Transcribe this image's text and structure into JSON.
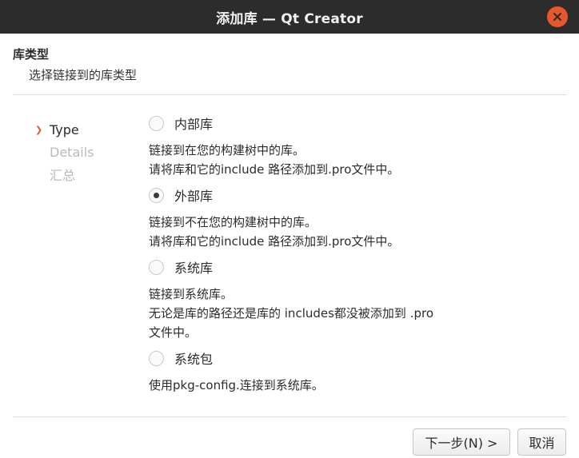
{
  "window": {
    "title": "添加库 — Qt Creator"
  },
  "header": {
    "title": "库类型",
    "subtitle": "选择链接到的库类型"
  },
  "steps": [
    {
      "label": "Type",
      "current": true
    },
    {
      "label": "Details",
      "current": false
    },
    {
      "label": "汇总",
      "current": false
    }
  ],
  "options": [
    {
      "label": "内部库",
      "checked": false,
      "desc": [
        "链接到在您的构建树中的库。",
        "请将库和它的include 路径添加到.pro文件中。"
      ]
    },
    {
      "label": "外部库",
      "checked": true,
      "desc": [
        "链接到不在您的构建树中的库。",
        "请将库和它的include 路径添加到.pro文件中。"
      ]
    },
    {
      "label": "系统库",
      "checked": false,
      "desc": [
        "链接到系统库。",
        "无论是库的路径还是库的 includes都没被添加到 .pro",
        "文件中。"
      ]
    },
    {
      "label": "系统包",
      "checked": false,
      "desc": [
        "使用pkg-config.连接到系统库。"
      ]
    }
  ],
  "buttons": {
    "next": "下一步(N) >",
    "cancel": "取消"
  },
  "colors": {
    "titlebar": "#2c2c2c",
    "close": "#e6582b",
    "accent": "#e05a2b"
  }
}
